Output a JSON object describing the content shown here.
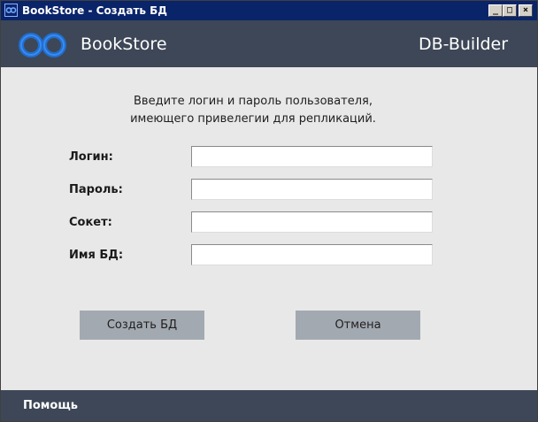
{
  "window": {
    "title": "BookStore - Создать БД",
    "controls": {
      "minimize": "_",
      "maximize": "□",
      "close": "×"
    }
  },
  "header": {
    "app_name": "BookStore",
    "product_name": "DB-Builder",
    "logo_icon": "infinity-logo-icon",
    "background": "#3d4757"
  },
  "form": {
    "instruction_line1": "Введите логин и пароль пользователя,",
    "instruction_line2": "имеющего привелегии для репликаций.",
    "fields": [
      {
        "label": "Логин:",
        "value": ""
      },
      {
        "label": "Пароль:",
        "value": ""
      },
      {
        "label": "Сокет:",
        "value": ""
      },
      {
        "label": "Имя БД:",
        "value": ""
      }
    ]
  },
  "buttons": {
    "create_label": "Создать БД",
    "cancel_label": "Отмена",
    "color": "#a3a9b1"
  },
  "footer": {
    "help_label": "Помощь"
  }
}
